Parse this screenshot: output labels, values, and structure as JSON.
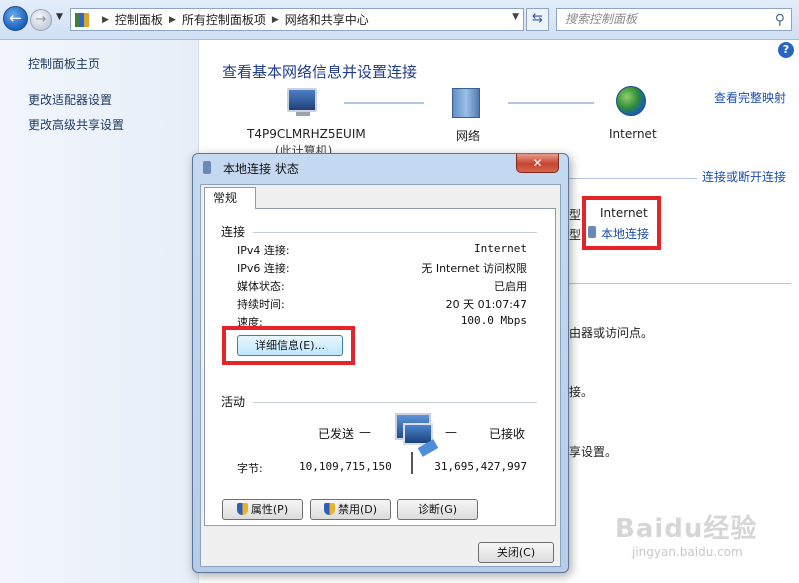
{
  "address_bar": {
    "breadcrumbs": [
      "控制面板",
      "所有控制面板项",
      "网络和共享中心"
    ],
    "search_placeholder": "搜索控制面板"
  },
  "left_pane": {
    "links": [
      "控制面板主页",
      "更改适配器设置",
      "更改高级共享设置"
    ]
  },
  "main": {
    "title": "查看基本网络信息并设置连接",
    "view_full_map": "查看完整映射",
    "nodes": {
      "computer": "T4P9CLMRHZ5EUIM",
      "computer_sub": "(此计算机)",
      "network": "网络",
      "internet": "Internet"
    },
    "connect_disconnect": "连接或断开连接",
    "access_type_suffix": "型:",
    "access_type_value": "Internet",
    "connection_suffix": "型:",
    "local_connection": "本地连接",
    "partial_lines": [
      "由器或访问点。",
      "接。",
      "享设置。"
    ]
  },
  "dialog": {
    "title": "本地连接 状态",
    "close": "✕",
    "tab": "常规",
    "connection_section": "连接",
    "rows": [
      {
        "key": "IPv4 连接:",
        "value": "Internet"
      },
      {
        "key": "IPv6 连接:",
        "value": "无 Internet 访问权限"
      },
      {
        "key": "媒体状态:",
        "value": "已启用"
      },
      {
        "key": "持续时间:",
        "value": "20 天 01:07:47"
      },
      {
        "key": "速度:",
        "value": "100.0 Mbps"
      }
    ],
    "details_button": "详细信息(E)...",
    "activity_section": "活动",
    "sent_label": "已发送",
    "received_label": "已接收",
    "bytes_label": "字节:",
    "bytes_sent": "10,109,715,150",
    "bytes_received": "31,695,427,997",
    "properties_button": "属性(P)",
    "disable_button": "禁用(D)",
    "diagnose_button": "诊断(G)",
    "close_button": "关闭(C)"
  },
  "watermark": {
    "logo": "Baidu经验",
    "url": "jingyan.baidu.com"
  },
  "colors": {
    "highlight": "#e3242b",
    "link": "#1c4fad",
    "title": "#1e3c8c"
  }
}
